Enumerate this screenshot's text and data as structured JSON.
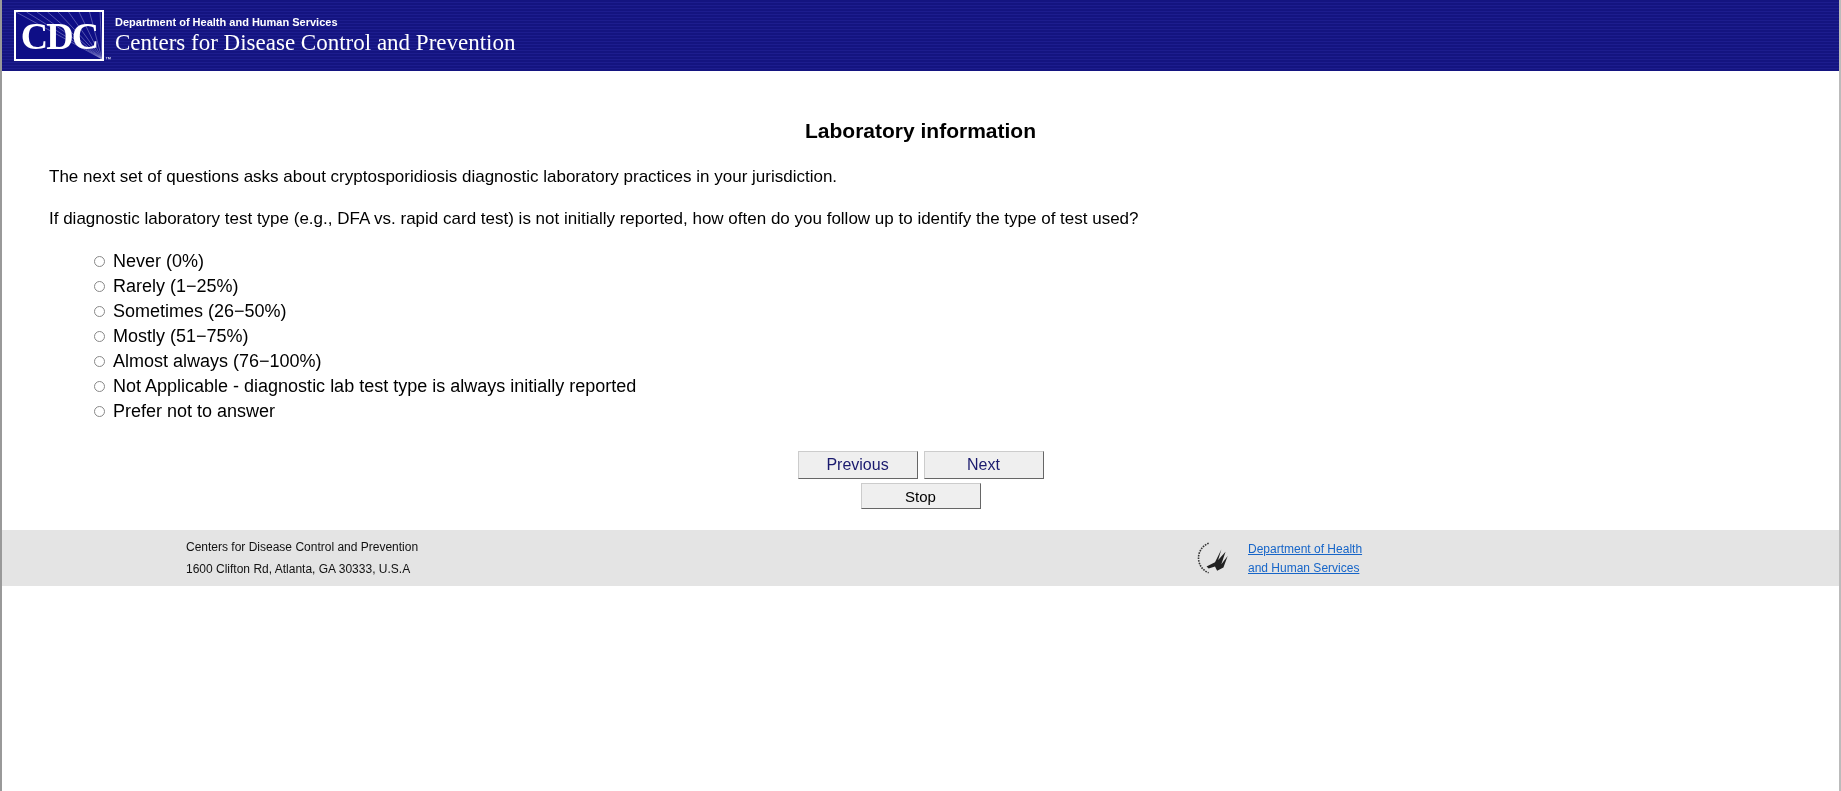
{
  "header": {
    "logo_text": "CDC",
    "trademark": "™",
    "department": "Department of Health and Human Services",
    "agency": "Centers for Disease Control and Prevention"
  },
  "page": {
    "title": "Laboratory information",
    "intro": "The next set of questions asks about cryptosporidiosis diagnostic laboratory practices in your jurisdiction.",
    "question": "If diagnostic laboratory test type (e.g., DFA vs. rapid card test) is not initially reported, how often do you follow up to identify the type of test used?"
  },
  "options": [
    {
      "label": "Never (0%)",
      "selected": false
    },
    {
      "label": "Rarely (1−25%)",
      "selected": false
    },
    {
      "label": "Sometimes (26−50%)",
      "selected": false
    },
    {
      "label": "Mostly (51−75%)",
      "selected": false
    },
    {
      "label": "Almost always (76−100%)",
      "selected": false
    },
    {
      "label": "Not Applicable - diagnostic lab test type is always initially reported",
      "selected": false
    },
    {
      "label": "Prefer not to answer",
      "selected": false
    }
  ],
  "buttons": {
    "previous": "Previous",
    "next": "Next",
    "stop": "Stop"
  },
  "footer": {
    "name": "Centers for Disease Control and Prevention",
    "address": "1600 Clifton Rd, Atlanta, GA 30333, U.S.A",
    "link_lines": [
      "Department of Health",
      "and Human Services"
    ]
  }
}
